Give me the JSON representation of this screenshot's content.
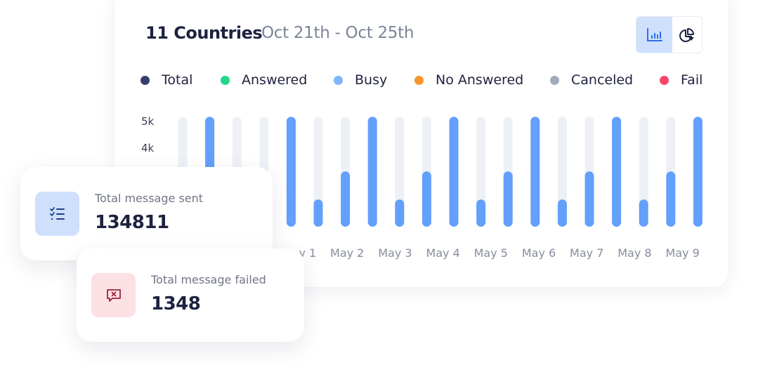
{
  "header": {
    "title": "11 Countries",
    "date_range": "Oct 21th - Oct 25th"
  },
  "view_toggle": {
    "options": [
      {
        "name": "bar-chart",
        "icon": "bar-chart-icon",
        "active": true
      },
      {
        "name": "pie-chart",
        "icon": "pie-chart-icon",
        "active": false
      }
    ]
  },
  "colors": {
    "bar": "#62a0fb",
    "bar_track": "#edf1f6",
    "title": "#1e2240",
    "subtitle": "#7b8497",
    "sent_icon_bg": "#cfe0fd",
    "sent_icon": "#1d3f8a",
    "failed_icon_bg": "#fde0e4",
    "failed_icon": "#9b2338"
  },
  "stats": {
    "sent": {
      "label": "Total message sent",
      "value": "134811",
      "icon": "checklist-icon"
    },
    "failed": {
      "label": "Total message failed",
      "value": "1348",
      "icon": "message-x-icon"
    }
  },
  "chart_data": {
    "type": "bar",
    "title": "11 Countries",
    "subtitle": "Oct 21th - Oct 25th",
    "legend": [
      {
        "label": "Total",
        "color": "#363f6b"
      },
      {
        "label": "Answered",
        "color": "#22d68a"
      },
      {
        "label": "Busy",
        "color": "#7fb6fb"
      },
      {
        "label": "No Answered",
        "color": "#f7962e"
      },
      {
        "label": "Canceled",
        "color": "#a3aabb"
      },
      {
        "label": "Fail",
        "color": "#f6476b"
      }
    ],
    "legend_position": "top",
    "y_ticks": [
      "5k",
      "4k"
    ],
    "y_tick_values": [
      5000,
      4000
    ],
    "x_tick_labels": [
      "May 1",
      "May 2",
      "May 3",
      "May 4",
      "May 5",
      "May 6",
      "May 7",
      "May 8",
      "May 9"
    ],
    "ylim": [
      1100,
      5200
    ],
    "track_max": 5200,
    "values": [
      null,
      5200,
      null,
      null,
      5200,
      2100,
      3150,
      5200,
      2100,
      3150,
      5200,
      2100,
      3150,
      5200,
      2100,
      3150,
      5200,
      2100,
      3150,
      5200
    ],
    "xlabel": "",
    "ylabel": "",
    "grid": false
  }
}
